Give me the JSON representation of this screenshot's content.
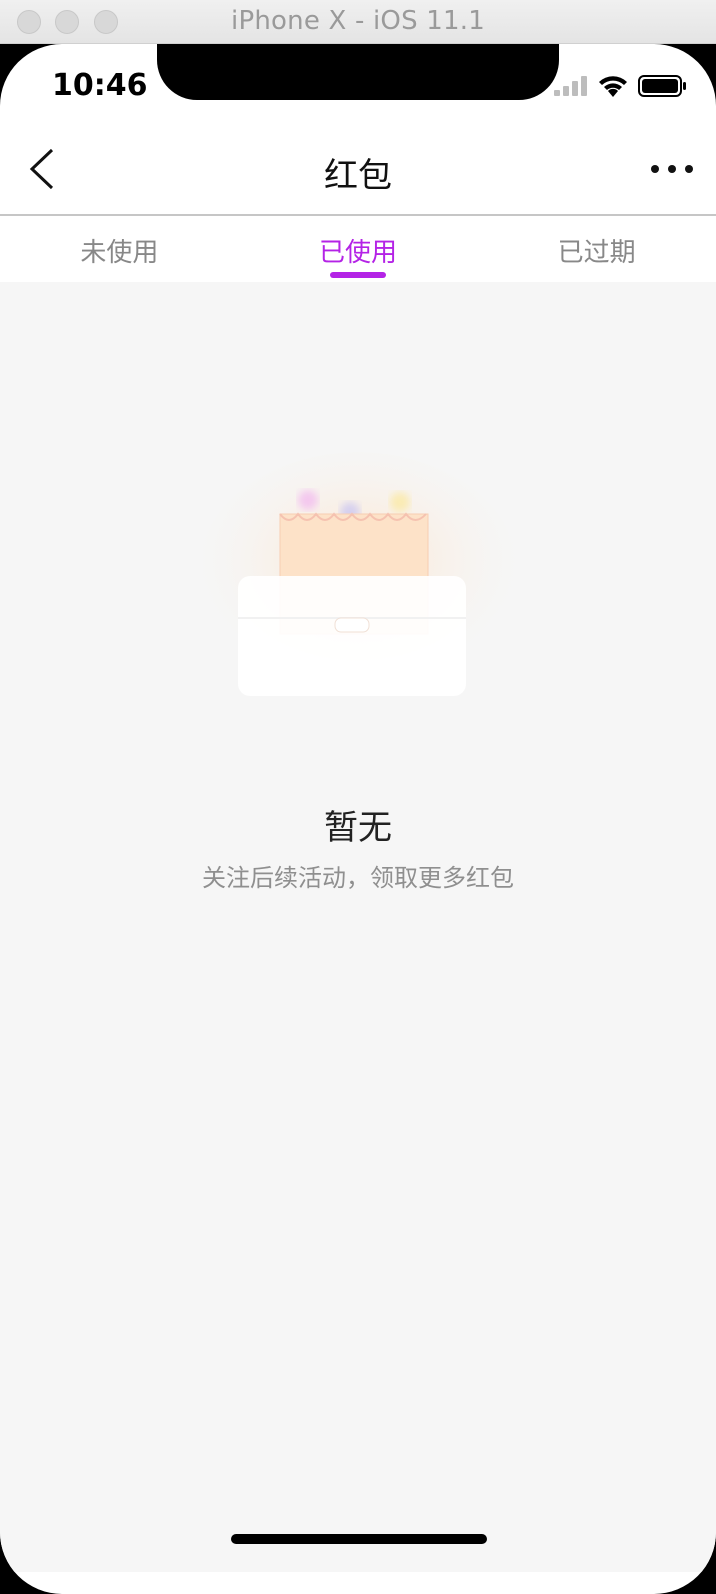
{
  "window": {
    "title": "iPhone X - iOS 11.1"
  },
  "status_bar": {
    "time": "10:46",
    "icons": [
      "cellular-signal-icon",
      "wifi-icon",
      "battery-icon"
    ]
  },
  "navbar": {
    "title": "红包",
    "back_icon": "chevron-left-icon",
    "more_icon": "more-dots-icon"
  },
  "tabs": [
    {
      "label": "未使用",
      "active": false
    },
    {
      "label": "已使用",
      "active": true
    },
    {
      "label": "已过期",
      "active": false
    }
  ],
  "empty_state": {
    "illustration": "red-envelope-box-icon",
    "title": "暂无",
    "subtitle": "关注后续活动，领取更多红包"
  },
  "colors": {
    "accent": "#b423e6",
    "background": "#f6f6f6",
    "muted_text": "#888888"
  }
}
